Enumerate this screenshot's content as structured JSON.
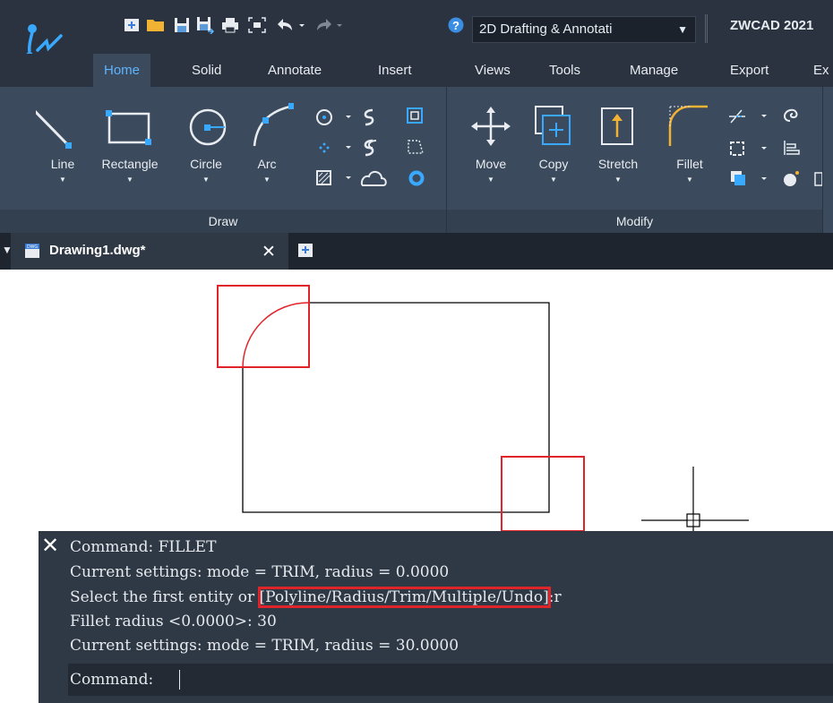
{
  "titlebar": {
    "workspace": "2D Drafting & Annotati",
    "app_title": "ZWCAD 2021",
    "quick_access": [
      "new-file-icon",
      "open-folder-icon",
      "save-icon",
      "save-as-icon",
      "print-icon",
      "zoom-extents-icon",
      "undo-icon",
      "redo-icon",
      "help-icon"
    ]
  },
  "tabs": [
    {
      "label": "Home",
      "active": true
    },
    {
      "label": "Solid"
    },
    {
      "label": "Annotate"
    },
    {
      "label": "Insert"
    },
    {
      "label": "Views"
    },
    {
      "label": "Tools"
    },
    {
      "label": "Manage"
    },
    {
      "label": "Export"
    },
    {
      "label": "Ex"
    }
  ],
  "ribbon": {
    "draw": {
      "title": "Draw",
      "tools": [
        {
          "label": "Line"
        },
        {
          "label": "Rectangle"
        },
        {
          "label": "Circle"
        },
        {
          "label": "Arc"
        }
      ]
    },
    "modify": {
      "title": "Modify",
      "tools": [
        {
          "label": "Move"
        },
        {
          "label": "Copy"
        },
        {
          "label": "Stretch"
        },
        {
          "label": "Fillet"
        }
      ]
    }
  },
  "document": {
    "name": "Drawing1.dwg*"
  },
  "command_line": {
    "lines": [
      "Command: FILLET",
      "Current settings: mode = TRIM, radius = 0.0000",
      "Select the first entity or ",
      "Fillet radius <0.0000>: 30",
      "Current settings: mode = TRIM, radius = 30.0000"
    ],
    "options": "[Polyline/Radius/Trim/Multiple/Undo]",
    "options_suffix": ":r",
    "prompt": "Command:"
  },
  "colors": {
    "highlight": "#e0242a",
    "accent": "#5fb4ff",
    "ribbon": "#3b4a5c",
    "titlebar": "#2b3340"
  }
}
